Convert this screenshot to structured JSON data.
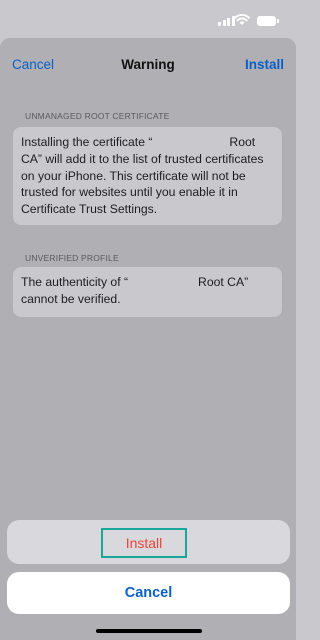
{
  "status": {
    "signal_bars": 4,
    "wifi": "wifi-icon",
    "battery": "battery-icon"
  },
  "nav": {
    "cancel": "Cancel",
    "title": "Warning",
    "install": "Install"
  },
  "sections": {
    "root_cert_header": "UNMANAGED ROOT CERTIFICATE",
    "root_cert_text_1": "Installing the certificate “",
    "root_cert_text_2": "Root",
    "root_cert_text_3": "CA” will add it to the list of trusted certificates on your iPhone. This certificate will not be trusted for websites until you enable it in Certificate Trust Settings.",
    "unverified_header": "UNVERIFIED PROFILE",
    "unverified_text_1": "The authenticity of “",
    "unverified_text_2": "Root CA”",
    "unverified_text_3": "cannot be verified."
  },
  "action_sheet": {
    "install": "Install",
    "cancel": "Cancel"
  },
  "colors": {
    "accent": "#0a60c8",
    "destructive": "#e6453a",
    "highlight": "#1aa79a"
  }
}
